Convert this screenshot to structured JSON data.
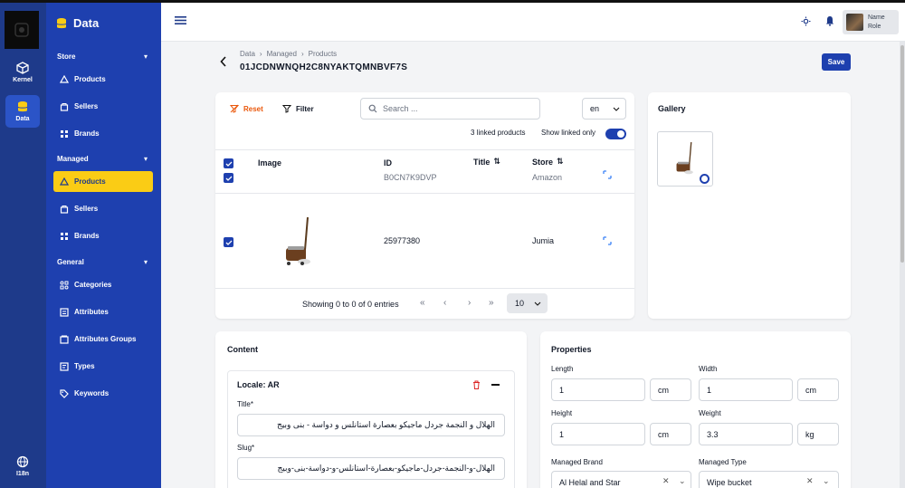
{
  "rail": {
    "items": [
      {
        "label": "Kernel",
        "icon": "box-icon"
      },
      {
        "label": "Data",
        "icon": "database-icon"
      },
      {
        "label": "I18n",
        "icon": "globe-icon"
      }
    ]
  },
  "sidebar": {
    "brand": "Data",
    "sections": [
      {
        "title": "Store",
        "items": [
          {
            "label": "Products",
            "icon": "product-icon"
          },
          {
            "label": "Sellers",
            "icon": "seller-icon"
          },
          {
            "label": "Brands",
            "icon": "brand-icon"
          }
        ]
      },
      {
        "title": "Managed",
        "items": [
          {
            "label": "Products",
            "icon": "product-icon"
          },
          {
            "label": "Sellers",
            "icon": "seller-icon"
          },
          {
            "label": "Brands",
            "icon": "brand-icon"
          }
        ]
      },
      {
        "title": "General",
        "items": [
          {
            "label": "Categories",
            "icon": "categories-icon"
          },
          {
            "label": "Attributes",
            "icon": "attributes-icon"
          },
          {
            "label": "Attributes Groups",
            "icon": "attributes-groups-icon"
          },
          {
            "label": "Types",
            "icon": "types-icon"
          },
          {
            "label": "Keywords",
            "icon": "tag-icon"
          }
        ]
      }
    ]
  },
  "header": {
    "user_name": "Name",
    "user_role": "Role"
  },
  "page": {
    "breadcrumb": [
      "Data",
      "Managed",
      "Products"
    ],
    "product_id": "01JCDNWNQH2C8NYAKTQMNBVF7S",
    "save_label": "Save"
  },
  "products_table": {
    "reset_label": "Reset",
    "filter_label": "Filter",
    "search_placeholder": "Search ...",
    "locale": "en",
    "linked_count_text": "3 linked products",
    "show_linked_label": "Show linked only",
    "show_linked_on": true,
    "columns": [
      "Image",
      "ID",
      "Title",
      "Store"
    ],
    "rows": [
      {
        "id": "B0CN7K9DVP",
        "title": "",
        "store": "Amazon",
        "checked": true
      },
      {
        "id": "25977380",
        "title": "",
        "store": "Jumia",
        "checked": true
      }
    ],
    "pagination_text": "Showing 0 to 0 of 0 entries",
    "page_size": "10"
  },
  "gallery": {
    "title": "Gallery"
  },
  "content": {
    "title": "Content",
    "locale_title": "Locale: AR",
    "title_label": "Title*",
    "title_value": "الهلال و النجمة جردل ماجيكو بعصارة استانلس و دواسة - بنى وبيج",
    "slug_label": "Slug*",
    "slug_value": "الهلال-و-النجمة-جردل-ماجيكو-بعصارة-استانلس-و-دواسة-بنى-وبيج"
  },
  "properties": {
    "title": "Properties",
    "length_label": "Length",
    "length_value": "1",
    "length_unit": "cm",
    "width_label": "Width",
    "width_value": "1",
    "width_unit": "cm",
    "height_label": "Height",
    "height_value": "1",
    "height_unit": "cm",
    "weight_label": "Weight",
    "weight_value": "3.3",
    "weight_unit": "kg",
    "brand_label": "Managed Brand",
    "brand_value": "Al Helal and Star",
    "type_label": "Managed Type",
    "type_value": "Wipe bucket"
  },
  "colors": {
    "primary": "#1e40af",
    "accent": "#facc15",
    "reset": "#ea580c",
    "delete": "#dc2626"
  }
}
